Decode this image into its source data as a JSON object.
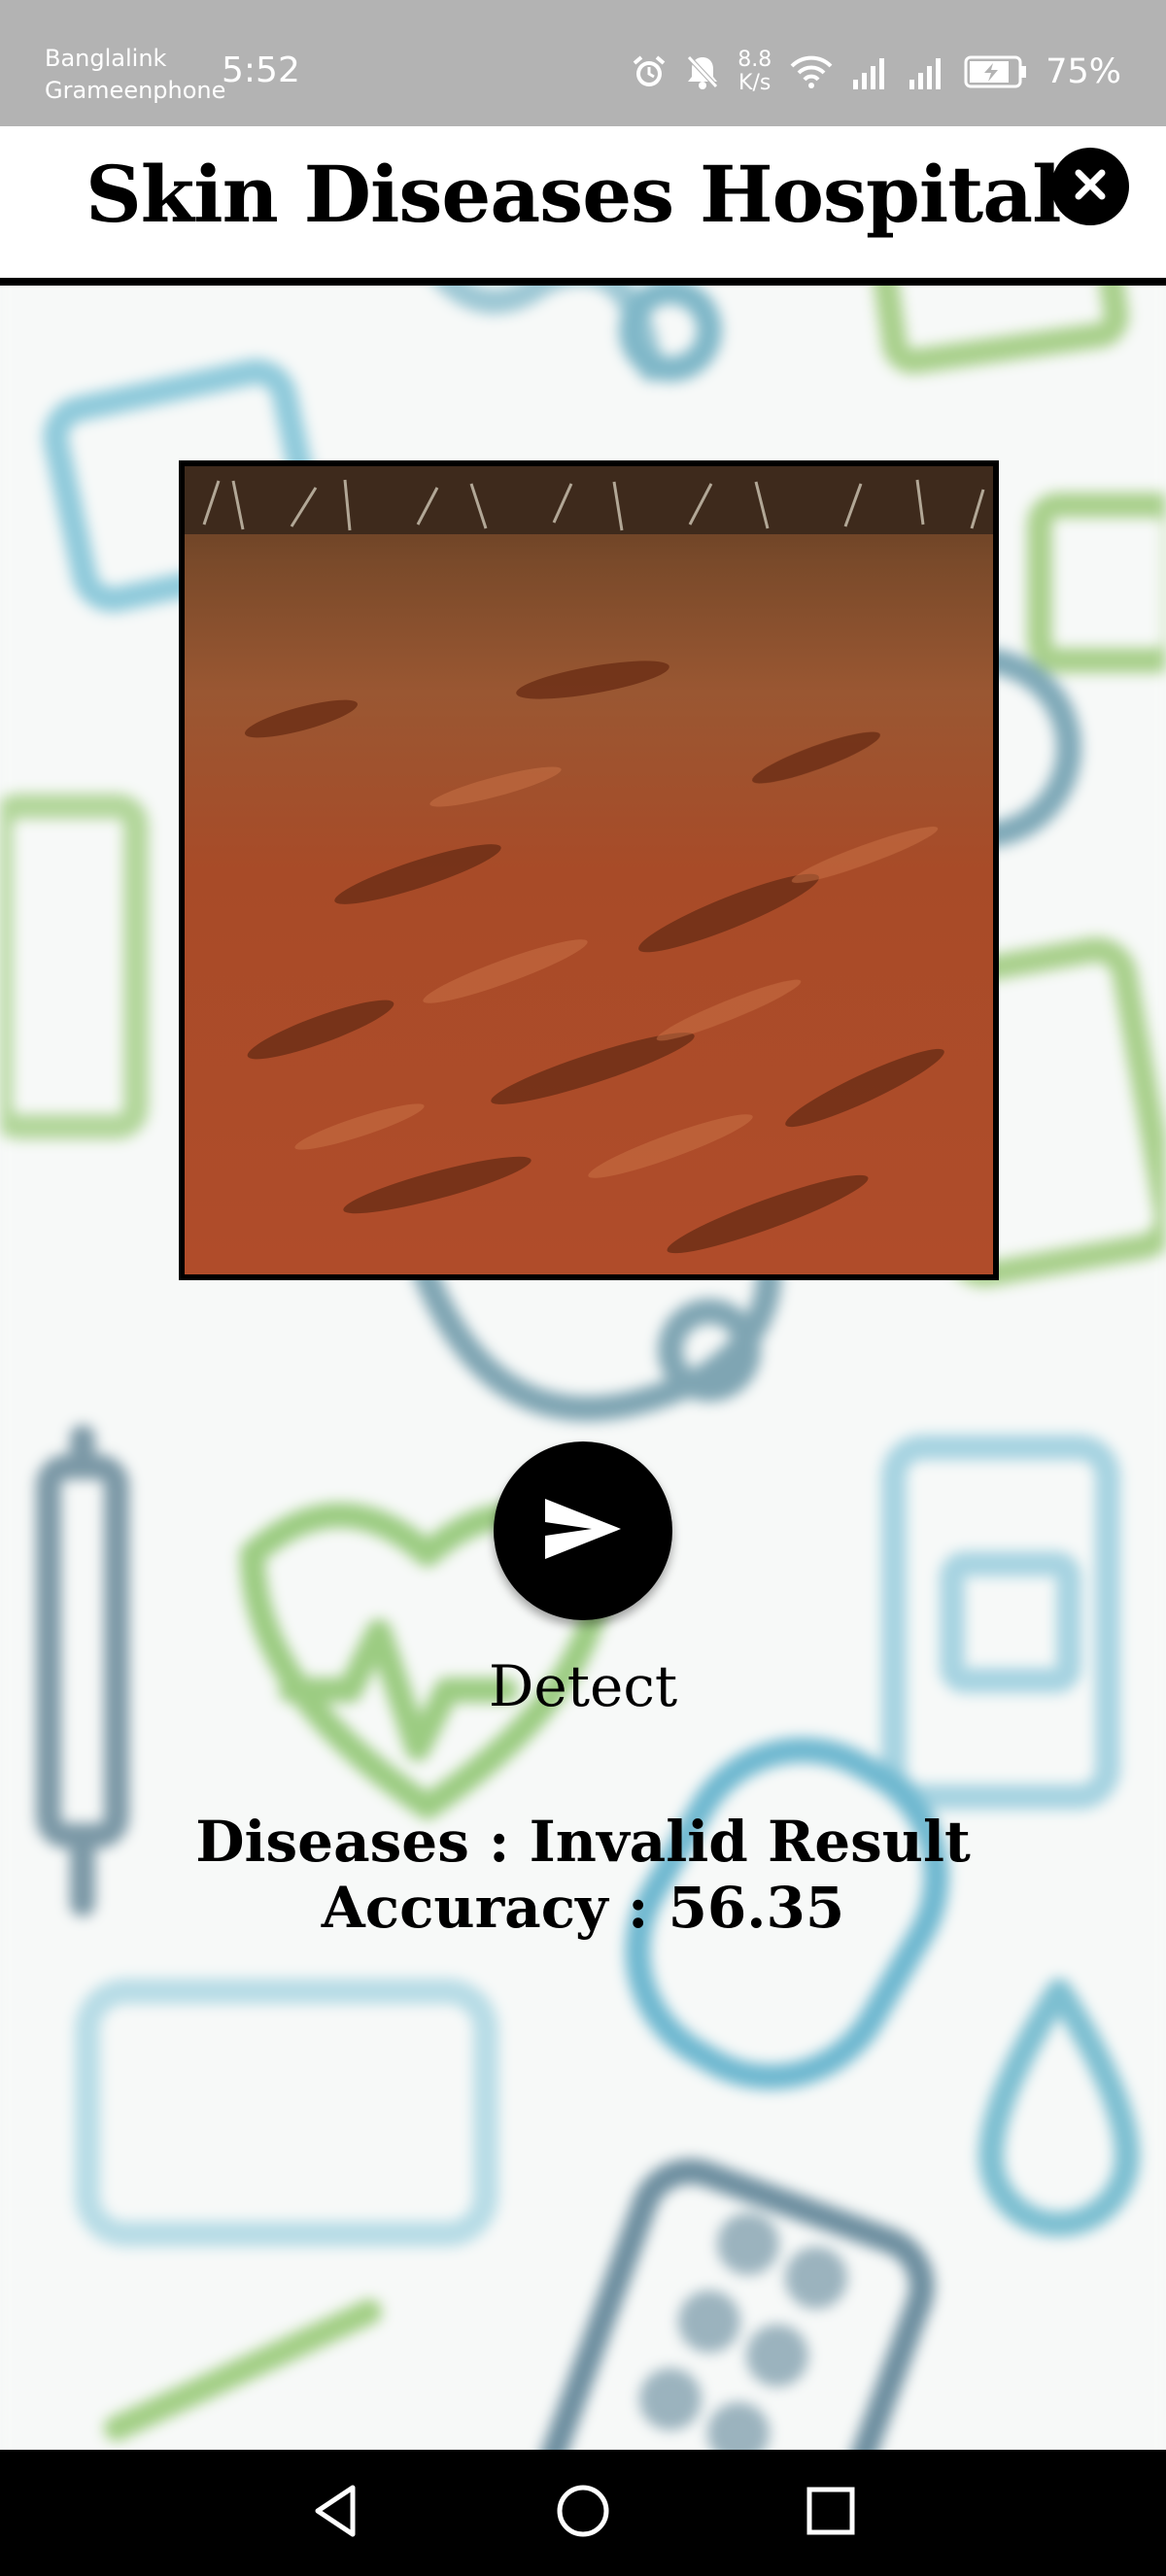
{
  "status_bar": {
    "carrier_1": "Banglalink",
    "carrier_2": "Grameenphone",
    "time": "5:52",
    "net_speed_value": "8.8",
    "net_speed_unit": "K/s",
    "battery_percent": "75%",
    "icons": [
      "alarm-icon",
      "mute-icon",
      "wifi-icon",
      "signal-icon",
      "signal-icon",
      "battery-icon"
    ]
  },
  "header": {
    "title": "Skin Diseases Hospital",
    "close_icon": "close-icon"
  },
  "main": {
    "detect_label": "Detect",
    "detect_icon": "send-icon",
    "result_disease_label": "Diseases : ",
    "result_disease_value": "Invalid Result",
    "result_accuracy_label": "Accuracy : ",
    "result_accuracy_value": "56.35"
  },
  "nav_bar": {
    "buttons": [
      "back-icon",
      "home-icon",
      "recents-icon"
    ]
  },
  "colors": {
    "status_bar_bg": "#b3b3b3",
    "header_bg": "#ffffff",
    "accent": "#000000",
    "background_icon_green": "#8fc06a",
    "background_icon_blue": "#7cc3d6"
  }
}
